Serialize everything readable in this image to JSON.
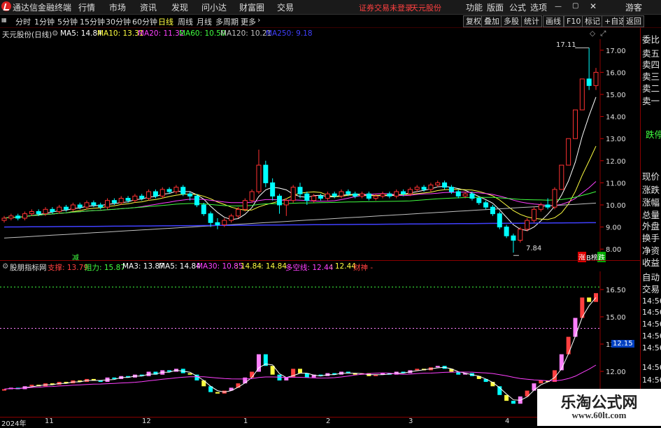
{
  "menubar": {
    "app_title": "通达信金融终端",
    "items": [
      "行情",
      "市场",
      "资讯",
      "发现",
      "问小达",
      "财富圈",
      "交易"
    ],
    "warning": "证券交易未登录",
    "stock_name": "天元股份",
    "right_items": [
      "功能",
      "版面",
      "公式",
      "选项"
    ],
    "user": "游客"
  },
  "toolbar": {
    "periods": [
      "分时",
      "1分钟",
      "5分钟",
      "15分钟",
      "30分钟",
      "60分钟",
      "日线",
      "周线",
      "月线",
      "多周期",
      "更多"
    ],
    "active_period": "日线",
    "buttons": [
      "复权",
      "叠加",
      "多股",
      "统计",
      "画线",
      "F10",
      "标记",
      "+自选",
      "返回"
    ]
  },
  "main_chart": {
    "title": "天元股份(日线)",
    "ma_legend": [
      {
        "label": "MA5: 14.84",
        "color": "#ffffff"
      },
      {
        "label": "MA10: 13.31",
        "color": "#ffff40"
      },
      {
        "label": "MA20: 11.32",
        "color": "#ff40ff"
      },
      {
        "label": "MA60: 10.50",
        "color": "#40ff40"
      },
      {
        "label": "MA120: 10.21",
        "color": "#c0c0c0"
      },
      {
        "label": "MA250: 9.18",
        "color": "#4040ff"
      }
    ],
    "annotations": {
      "high": "17.11",
      "low": "7.84",
      "reduce_mark": "减",
      "tag_red": "涨",
      "tag_green": "跌",
      "tag_mid": "B榜"
    }
  },
  "indicator": {
    "title": "股朋指标网",
    "legend": [
      {
        "label": "支撑: 13.79",
        "color": "#ff4040"
      },
      {
        "label": "阻力: 15.87",
        "color": "#40ff40"
      },
      {
        "label": "MA3: 13.87",
        "color": "#ffffff"
      },
      {
        "label": "MA5: 14.84",
        "color": "#ffffff"
      },
      {
        "label": "MA30: 10.85",
        "color": "#ff40ff"
      },
      {
        "label": ": 14.84",
        "color": "#ffff40"
      },
      {
        "label": ": 14.84",
        "color": "#ffff40"
      },
      {
        "label": "多空线: 12.44",
        "color": "#ff40ff"
      },
      {
        "label": ": 12.44",
        "color": "#ffff40"
      },
      {
        "label": "财神 -",
        "color": "#ff4040"
      }
    ],
    "current_value": "12.15"
  },
  "date_axis": [
    "2024年",
    "11",
    "12",
    "1",
    "2",
    "3",
    "4"
  ],
  "side_panel": {
    "top_items": [
      "委比",
      "卖五",
      "卖四",
      "卖三",
      "卖二",
      "卖一"
    ],
    "stop_label": "跌停",
    "info_items": [
      "现价",
      "涨跌",
      "涨幅",
      "总量",
      "外盘",
      "换手",
      "净资",
      "收益"
    ],
    "bottom_items": [
      "自动",
      "交易"
    ],
    "times": [
      "14:56",
      "14:56",
      "14:56",
      "14:56",
      "14:56",
      "14:56",
      "14:56"
    ]
  },
  "watermark": {
    "line1": "乐淘公式网",
    "line2": "www.60lt.com"
  },
  "chart_data": [
    {
      "type": "candlestick",
      "title": "天元股份(日线)",
      "ylim": [
        7.5,
        17.5
      ],
      "yticks": [
        8.0,
        9.0,
        10.0,
        11.0,
        12.0,
        13.0,
        14.0,
        15.0,
        16.0,
        17.0
      ],
      "candles": [
        [
          9.3,
          9.4,
          9.5,
          9.2
        ],
        [
          9.4,
          9.5,
          9.6,
          9.3
        ],
        [
          9.5,
          9.4,
          9.6,
          9.3
        ],
        [
          9.4,
          9.6,
          9.7,
          9.3
        ],
        [
          9.6,
          9.7,
          9.8,
          9.5
        ],
        [
          9.7,
          9.6,
          9.8,
          9.5
        ],
        [
          9.6,
          9.8,
          9.9,
          9.5
        ],
        [
          9.8,
          9.7,
          9.9,
          9.6
        ],
        [
          9.7,
          9.9,
          10.0,
          9.6
        ],
        [
          9.9,
          9.8,
          10.0,
          9.7
        ],
        [
          9.8,
          10.0,
          10.1,
          9.7
        ],
        [
          10.0,
          9.9,
          10.1,
          9.8
        ],
        [
          9.9,
          10.1,
          10.2,
          9.8
        ],
        [
          10.1,
          10.0,
          10.2,
          9.9
        ],
        [
          10.0,
          9.9,
          10.1,
          9.8
        ],
        [
          9.9,
          10.2,
          10.3,
          9.8
        ],
        [
          10.2,
          10.1,
          10.3,
          10.0
        ],
        [
          10.1,
          10.3,
          10.4,
          10.0
        ],
        [
          10.3,
          10.2,
          10.4,
          10.1
        ],
        [
          10.2,
          10.4,
          10.5,
          10.1
        ],
        [
          10.4,
          10.3,
          10.5,
          10.2
        ],
        [
          10.3,
          10.6,
          10.7,
          10.2
        ],
        [
          10.6,
          10.4,
          10.7,
          10.3
        ],
        [
          10.4,
          10.7,
          10.8,
          10.3
        ],
        [
          10.7,
          10.6,
          10.8,
          10.5
        ],
        [
          10.6,
          10.8,
          10.9,
          10.5
        ],
        [
          10.8,
          10.5,
          10.9,
          10.4
        ],
        [
          10.5,
          10.4,
          10.6,
          10.2
        ],
        [
          10.4,
          10.0,
          10.5,
          9.9
        ],
        [
          10.0,
          9.6,
          10.1,
          9.5
        ],
        [
          9.6,
          9.2,
          9.7,
          9.0
        ],
        [
          9.2,
          9.1,
          9.4,
          8.9
        ],
        [
          9.1,
          9.3,
          9.4,
          9.0
        ],
        [
          9.3,
          9.5,
          9.6,
          9.2
        ],
        [
          9.5,
          9.8,
          9.9,
          9.4
        ],
        [
          9.8,
          10.2,
          10.3,
          9.7
        ],
        [
          10.2,
          10.6,
          10.7,
          10.1
        ],
        [
          10.6,
          11.8,
          12.5,
          10.5
        ],
        [
          11.8,
          11.0,
          12.0,
          10.8
        ],
        [
          11.0,
          10.4,
          11.2,
          10.2
        ],
        [
          10.4,
          10.0,
          10.5,
          9.6
        ],
        [
          10.0,
          10.2,
          10.3,
          9.5
        ],
        [
          10.2,
          10.8,
          10.9,
          10.1
        ],
        [
          10.8,
          10.5,
          11.0,
          10.3
        ],
        [
          10.5,
          10.2,
          10.6,
          10.0
        ],
        [
          10.2,
          10.4,
          10.5,
          10.1
        ],
        [
          10.4,
          10.3,
          10.5,
          10.2
        ],
        [
          10.3,
          10.5,
          10.6,
          10.2
        ],
        [
          10.5,
          10.4,
          10.6,
          10.3
        ],
        [
          10.4,
          10.6,
          10.7,
          10.3
        ],
        [
          10.6,
          10.5,
          10.7,
          10.4
        ],
        [
          10.5,
          10.4,
          10.6,
          10.3
        ],
        [
          10.4,
          10.5,
          10.6,
          10.3
        ],
        [
          10.5,
          10.3,
          10.6,
          10.2
        ],
        [
          10.3,
          10.4,
          10.5,
          10.2
        ],
        [
          10.4,
          10.5,
          10.6,
          10.3
        ],
        [
          10.5,
          10.4,
          10.6,
          10.3
        ],
        [
          10.4,
          10.6,
          10.7,
          10.3
        ],
        [
          10.6,
          10.5,
          10.7,
          10.4
        ],
        [
          10.5,
          10.7,
          10.8,
          10.4
        ],
        [
          10.7,
          10.8,
          10.9,
          10.6
        ],
        [
          10.8,
          10.7,
          10.9,
          10.6
        ],
        [
          10.7,
          10.9,
          11.0,
          10.6
        ],
        [
          10.9,
          11.0,
          11.1,
          10.8
        ],
        [
          11.0,
          10.8,
          11.1,
          10.7
        ],
        [
          10.8,
          10.6,
          10.9,
          10.5
        ],
        [
          10.6,
          10.4,
          10.7,
          10.3
        ],
        [
          10.4,
          10.5,
          10.6,
          10.3
        ],
        [
          10.5,
          10.3,
          10.6,
          10.2
        ],
        [
          10.3,
          10.1,
          10.4,
          10.0
        ],
        [
          10.1,
          9.9,
          10.2,
          9.8
        ],
        [
          9.9,
          9.6,
          10.0,
          9.5
        ],
        [
          9.6,
          9.0,
          9.7,
          8.9
        ],
        [
          9.0,
          8.6,
          9.1,
          8.5
        ],
        [
          8.6,
          8.4,
          8.7,
          7.84
        ],
        [
          8.4,
          8.9,
          9.0,
          8.3
        ],
        [
          8.9,
          9.3,
          9.4,
          8.8
        ],
        [
          9.3,
          9.8,
          9.9,
          9.2
        ],
        [
          9.8,
          10.0,
          10.1,
          9.7
        ],
        [
          10.0,
          9.9,
          10.3,
          9.8
        ],
        [
          9.9,
          10.7,
          10.8,
          9.8
        ],
        [
          10.7,
          11.8,
          11.8,
          10.7
        ],
        [
          11.8,
          13.0,
          13.0,
          11.8
        ],
        [
          13.0,
          14.3,
          14.3,
          13.0
        ],
        [
          14.3,
          15.7,
          15.7,
          14.3
        ],
        [
          15.7,
          15.4,
          17.11,
          15.2
        ],
        [
          15.4,
          16.0,
          16.2,
          15.2
        ]
      ]
    },
    {
      "type": "indicator-bar",
      "title": "股朋指标网",
      "ylim": [
        9.5,
        17.5
      ],
      "yticks": [
        10.5,
        12.0,
        13.5,
        15.0,
        16.5
      ],
      "support": 13.79,
      "resistance": 15.87,
      "last_value": 12.15
    }
  ]
}
